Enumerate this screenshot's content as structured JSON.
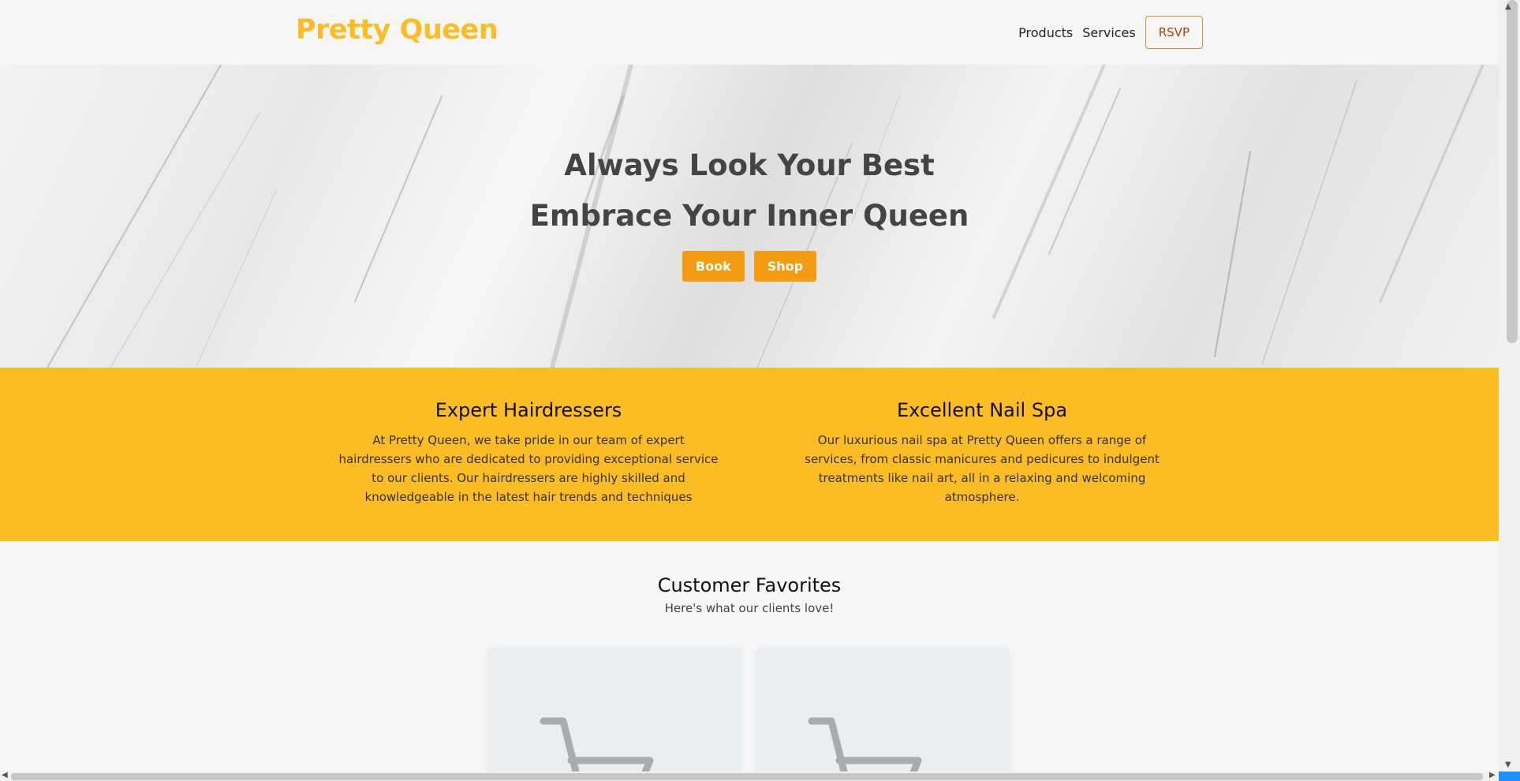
{
  "brand": {
    "logo": "Pretty Queen",
    "accent": "#fbbc24",
    "button_color": "#f39c12"
  },
  "nav": {
    "products": "Products",
    "services": "Services",
    "rsvp": "RSVP"
  },
  "hero": {
    "line1": "Always Look Your Best",
    "line2": "Embrace Your Inner Queen",
    "book": "Book",
    "shop": "Shop"
  },
  "features": [
    {
      "title": "Expert Hairdressers",
      "text": "At Pretty Queen, we take pride in our team of expert hairdressers who are dedicated to providing exceptional service to our clients. Our hairdressers are highly skilled and knowledgeable in the latest hair trends and techniques"
    },
    {
      "title": "Excellent Nail Spa",
      "text": "Our luxurious nail spa at Pretty Queen offers a range of services, from classic manicures and pedicures to indulgent treatments like nail art, all in a relaxing and welcoming atmosphere."
    }
  ],
  "favorites": {
    "title": "Customer Favorites",
    "subtitle": "Here's what our clients love!"
  },
  "icons": [
    "shopping-cart-icon",
    "shopping-cart-icon"
  ]
}
